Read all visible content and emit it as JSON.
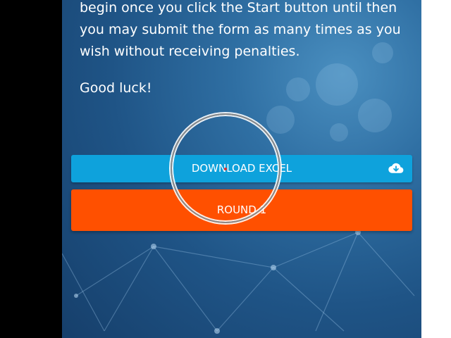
{
  "instructions": {
    "paragraph": "begin once you click the Start button until then you may submit the form as many times as you wish without receiving penalties.",
    "good_luck": "Good luck!"
  },
  "buttons": {
    "download_label": "DOWNLOAD EXCEL",
    "download_icon": "cloud-download-icon",
    "round_label": "ROUND 1"
  },
  "colors": {
    "download_button": "#0ea2dc",
    "round_button": "#ff5000",
    "panel_background": "#1f5486"
  }
}
